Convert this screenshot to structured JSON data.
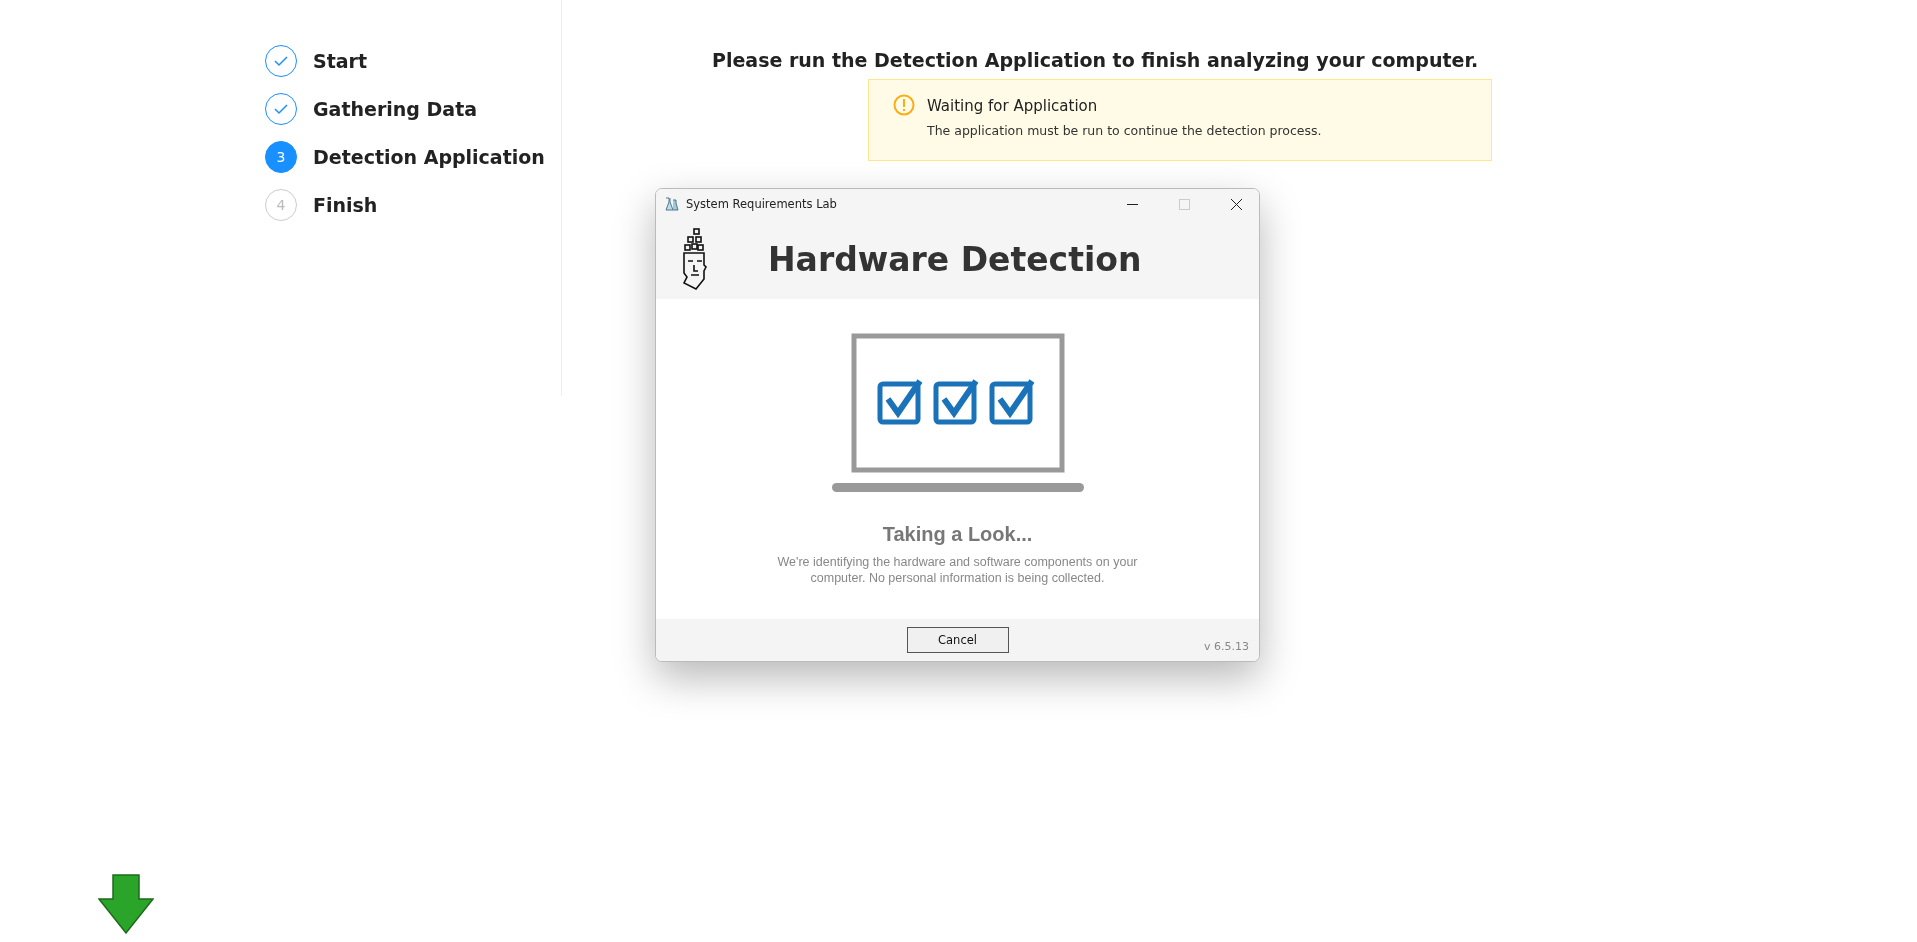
{
  "steps": [
    {
      "label": "Start",
      "kind": "done"
    },
    {
      "label": "Gathering Data",
      "kind": "done"
    },
    {
      "label": "Detection Application",
      "kind": "current",
      "marker": "3"
    },
    {
      "label": "Finish",
      "kind": "pending",
      "marker": "4"
    }
  ],
  "heading": "Please run the Detection Application to finish analyzing your computer.",
  "alert": {
    "title": "Waiting for Application",
    "message": "The application must be run to continue the detection process."
  },
  "dialog": {
    "title": "System Requirements Lab",
    "header": "Hardware Detection",
    "status_title": "Taking a Look...",
    "status_text": "We're identifying the hardware and software components on your computer. No personal information is being collected.",
    "cancel": "Cancel",
    "version": "v 6.5.13",
    "maximize_disabled": true
  }
}
